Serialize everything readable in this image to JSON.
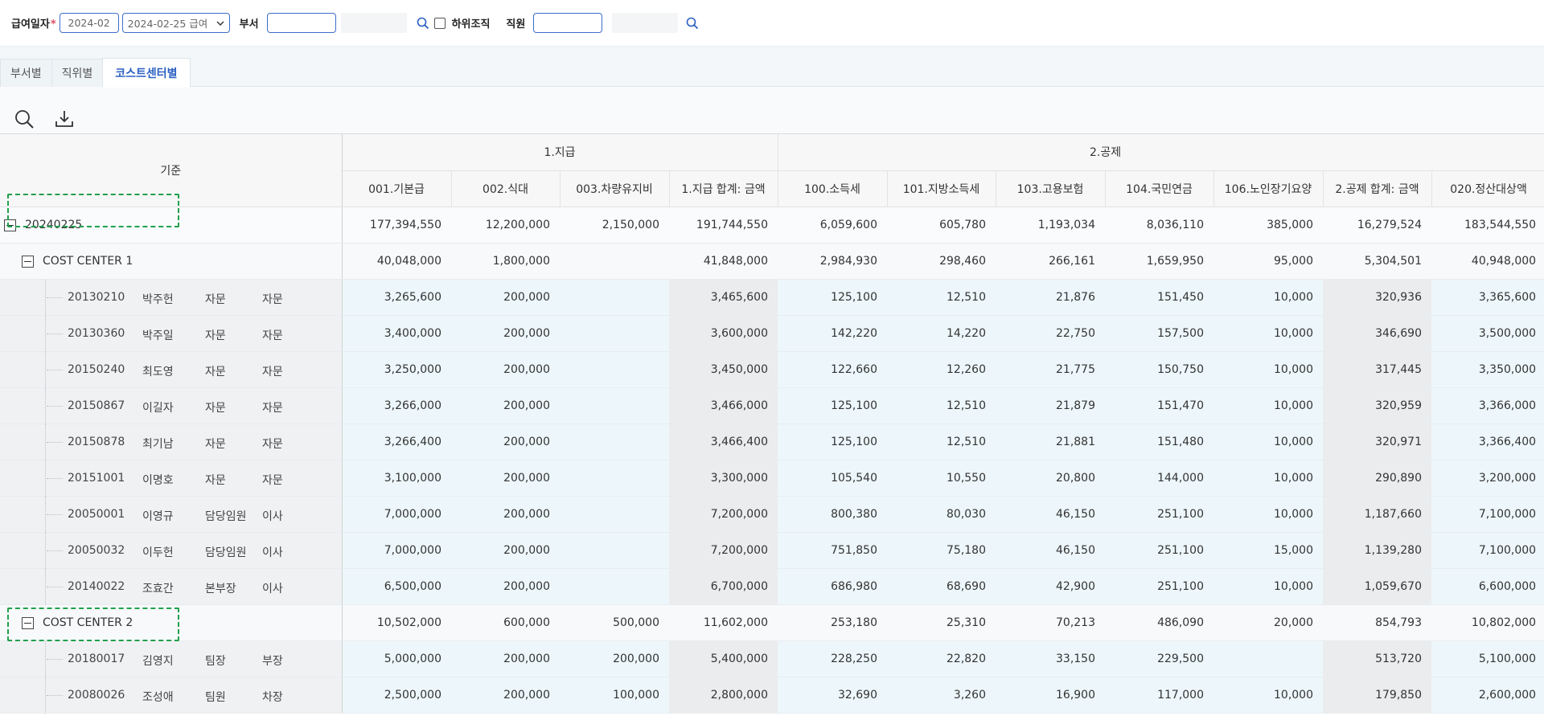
{
  "filter": {
    "pay_date_label": "급여일자",
    "required_mark": "*",
    "month_value": "2024-02",
    "payroll_value": "2024-02-25 급여",
    "dept_label": "부서",
    "dept_code": "",
    "dept_name": "",
    "sub_org_label": "하위조직",
    "employee_label": "직원",
    "employee_code": "",
    "employee_name": ""
  },
  "tabs": [
    {
      "label": "부서별"
    },
    {
      "label": "직위별"
    },
    {
      "label": "코스트센터별"
    }
  ],
  "grid": {
    "basis_header": "기준",
    "group_headers": [
      "1.지급",
      "2.공제"
    ],
    "columns": [
      "001.기본급",
      "002.식대",
      "003.차량유지비",
      "1.지급 합계: 금액",
      "100.소득세",
      "101.지방소득세",
      "103.고용보험",
      "104.국민연금",
      "106.노인장기요양",
      "2.공제 합계: 금액",
      "020.정산대상액"
    ],
    "total": {
      "label": "20240225",
      "values": [
        "177,394,550",
        "12,200,000",
        "2,150,000",
        "191,744,550",
        "6,059,600",
        "605,780",
        "1,193,034",
        "8,036,110",
        "385,000",
        "16,279,524",
        "183,544,550"
      ]
    },
    "groups": [
      {
        "label": "COST CENTER 1",
        "values": [
          "40,048,000",
          "1,800,000",
          "",
          "41,848,000",
          "2,984,930",
          "298,460",
          "266,161",
          "1,659,950",
          "95,000",
          "5,304,501",
          "40,948,000"
        ],
        "rows": [
          {
            "code": "20130210",
            "name": "박주헌",
            "title": "자문",
            "position": "자문",
            "values": [
              "3,265,600",
              "200,000",
              "",
              "3,465,600",
              "125,100",
              "12,510",
              "21,876",
              "151,450",
              "10,000",
              "320,936",
              "3,365,600"
            ]
          },
          {
            "code": "20130360",
            "name": "박주일",
            "title": "자문",
            "position": "자문",
            "values": [
              "3,400,000",
              "200,000",
              "",
              "3,600,000",
              "142,220",
              "14,220",
              "22,750",
              "157,500",
              "10,000",
              "346,690",
              "3,500,000"
            ]
          },
          {
            "code": "20150240",
            "name": "최도영",
            "title": "자문",
            "position": "자문",
            "values": [
              "3,250,000",
              "200,000",
              "",
              "3,450,000",
              "122,660",
              "12,260",
              "21,775",
              "150,750",
              "10,000",
              "317,445",
              "3,350,000"
            ]
          },
          {
            "code": "20150867",
            "name": "이길자",
            "title": "자문",
            "position": "자문",
            "values": [
              "3,266,000",
              "200,000",
              "",
              "3,466,000",
              "125,100",
              "12,510",
              "21,879",
              "151,470",
              "10,000",
              "320,959",
              "3,366,000"
            ]
          },
          {
            "code": "20150878",
            "name": "최기남",
            "title": "자문",
            "position": "자문",
            "values": [
              "3,266,400",
              "200,000",
              "",
              "3,466,400",
              "125,100",
              "12,510",
              "21,881",
              "151,480",
              "10,000",
              "320,971",
              "3,366,400"
            ]
          },
          {
            "code": "20151001",
            "name": "이명호",
            "title": "자문",
            "position": "자문",
            "values": [
              "3,100,000",
              "200,000",
              "",
              "3,300,000",
              "105,540",
              "10,550",
              "20,800",
              "144,000",
              "10,000",
              "290,890",
              "3,200,000"
            ]
          },
          {
            "code": "20050001",
            "name": "이영규",
            "title": "담당임원",
            "position": "이사",
            "values": [
              "7,000,000",
              "200,000",
              "",
              "7,200,000",
              "800,380",
              "80,030",
              "46,150",
              "251,100",
              "10,000",
              "1,187,660",
              "7,100,000"
            ]
          },
          {
            "code": "20050032",
            "name": "이두헌",
            "title": "담당임원",
            "position": "이사",
            "values": [
              "7,000,000",
              "200,000",
              "",
              "7,200,000",
              "751,850",
              "75,180",
              "46,150",
              "251,100",
              "15,000",
              "1,139,280",
              "7,100,000"
            ]
          },
          {
            "code": "20140022",
            "name": "조효간",
            "title": "본부장",
            "position": "이사",
            "values": [
              "6,500,000",
              "200,000",
              "",
              "6,700,000",
              "686,980",
              "68,690",
              "42,900",
              "251,100",
              "10,000",
              "1,059,670",
              "6,600,000"
            ]
          }
        ]
      },
      {
        "label": "COST CENTER 2",
        "values": [
          "10,502,000",
          "600,000",
          "500,000",
          "11,602,000",
          "253,180",
          "25,310",
          "70,213",
          "486,090",
          "20,000",
          "854,793",
          "10,802,000"
        ],
        "rows": [
          {
            "code": "20180017",
            "name": "김영지",
            "title": "팀장",
            "position": "부장",
            "values": [
              "5,000,000",
              "200,000",
              "200,000",
              "5,400,000",
              "228,250",
              "22,820",
              "33,150",
              "229,500",
              "",
              "513,720",
              "5,100,000"
            ]
          },
          {
            "code": "20080026",
            "name": "조성애",
            "title": "팀원",
            "position": "차장",
            "values": [
              "2,500,000",
              "200,000",
              "100,000",
              "2,800,000",
              "32,690",
              "3,260",
              "16,900",
              "117,000",
              "10,000",
              "179,850",
              "2,600,000"
            ]
          }
        ]
      }
    ]
  },
  "colors": {
    "accent": "#2a5fc2",
    "highlight": "#22a04b",
    "leaf_bg": "#edf7fb",
    "sum_bg": "#ebecee"
  }
}
